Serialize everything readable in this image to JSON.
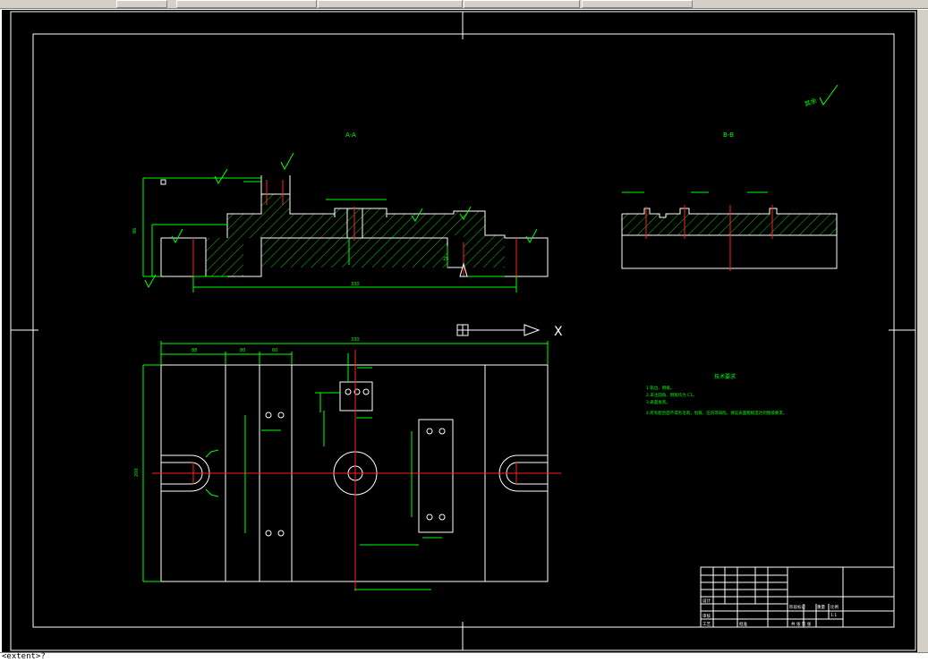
{
  "colors": {
    "background": "#000000",
    "outline": "#ffffff",
    "dimension": "#00ff00",
    "centerline": "#ff2020",
    "chrome": "#d4d0c8"
  },
  "drawing": {
    "section_a_label": "A-A",
    "section_b_label": "B-B",
    "roughness_note": "其余",
    "tech_req_title": "技术要求",
    "tech_req_lines": [
      "1.锐边、倒棱。",
      "2.未注圆角、倒角均为 C1。",
      "3.表面发黑。",
      "4.所有配合面不得有毛刺，划痕、压伤等缺陷，保证表面粗糙度达到图纸要求。"
    ],
    "ucs_axis_label": "X",
    "dims": {
      "left_height": "86",
      "overall_width": "330",
      "plan_width": "330",
      "plan_height": "200",
      "base_thickness": "25",
      "seg_1": "88",
      "seg_2": "80",
      "seg_3": "60"
    }
  },
  "title_block": {
    "design_label": "设计",
    "check_label": "审核",
    "process_label": "工艺",
    "approve_label": "批准",
    "scale_label": "比例",
    "weight_label": "重量",
    "stage_label": "阶段标记",
    "scale_value": "1:1",
    "sheets_label": "共  张  第  张"
  },
  "command_line": {
    "text": "<extent>?"
  }
}
